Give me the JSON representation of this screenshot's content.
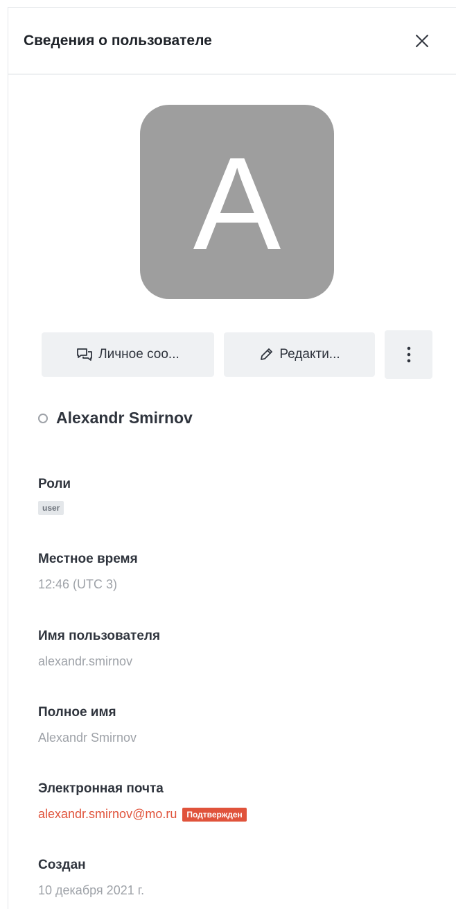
{
  "header": {
    "title": "Сведения о пользователе"
  },
  "avatar": {
    "letter": "A",
    "color": "#9e9e9e"
  },
  "actions": {
    "direct_message": "Личное соо...",
    "edit": "Редакти..."
  },
  "user": {
    "name": "Alexandr Smirnov",
    "status": "offline"
  },
  "fields": {
    "roles": {
      "label": "Роли",
      "tags": [
        "user"
      ]
    },
    "local_time": {
      "label": "Местное время",
      "value": "12:46 (UTC 3)"
    },
    "username": {
      "label": "Имя пользователя",
      "value": "alexandr.smirnov"
    },
    "full_name": {
      "label": "Полное имя",
      "value": "Alexandr Smirnov"
    },
    "email": {
      "label": "Электронная почта",
      "value": "alexandr.smirnov@mo.ru",
      "badge": "Подтвержден"
    },
    "created": {
      "label": "Создан",
      "value": "10 декабря 2021 г."
    }
  },
  "colors": {
    "accent": "#e0533b",
    "muted": "#9ea2a8",
    "button_bg": "#eff1f3"
  },
  "icons": [
    "close-icon",
    "chat-icon",
    "pencil-icon",
    "kebab-menu-icon",
    "status-dot-icon"
  ]
}
